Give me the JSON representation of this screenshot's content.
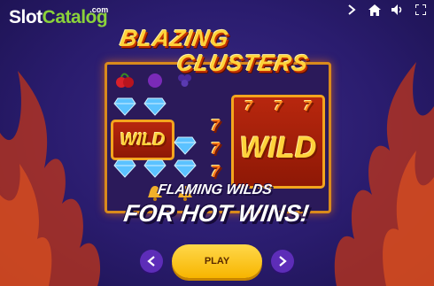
{
  "watermark": {
    "brand_slot": "Slot",
    "brand_catalog": "Catalog",
    "brand_com": ".com"
  },
  "top_bar": {
    "icons": [
      "chevron-right-icon",
      "home-icon",
      "sound-icon",
      "fullscreen-icon"
    ]
  },
  "logo": {
    "line1": "BLAZING",
    "line2": "CLUSTERS"
  },
  "board": {
    "wild_label": "WILD",
    "seven_symbol": "7"
  },
  "tagline": {
    "line1": "FLAMING WILDS",
    "line2": "FOR HOT WINS!"
  },
  "controls": {
    "play_label": "PLAY"
  },
  "colors": {
    "background": "#2a1c6e",
    "flame": "#e0461a",
    "accent_yellow": "#ffd23a",
    "button_purple": "#5d2db8"
  }
}
